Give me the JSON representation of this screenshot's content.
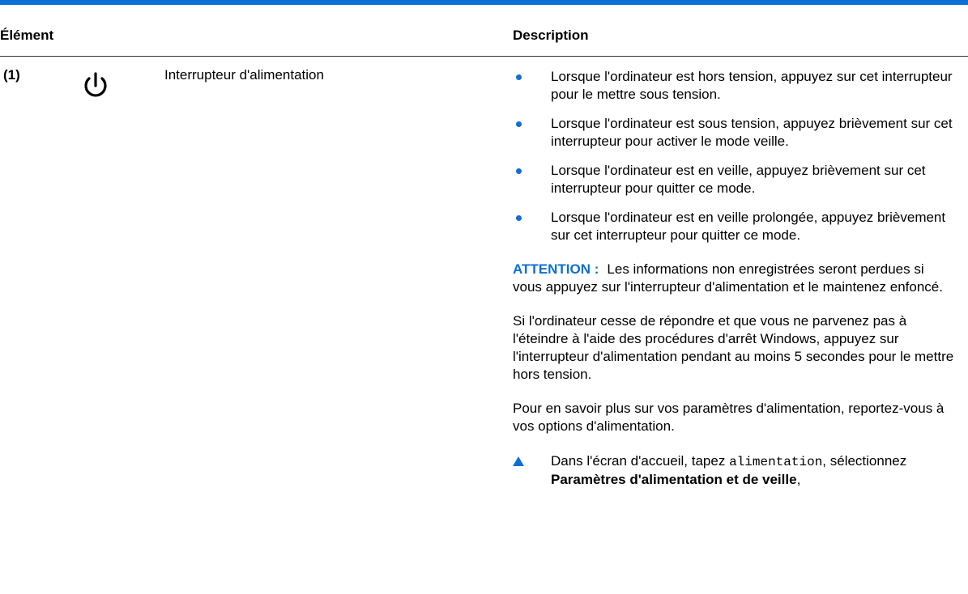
{
  "table": {
    "header_element": "Élément",
    "header_description": "Description"
  },
  "row": {
    "index": "(1)",
    "icon": "power-icon",
    "name": "Interrupteur d'alimentation",
    "bullets": [
      "Lorsque l'ordinateur est hors tension, appuyez sur cet interrupteur pour le mettre sous tension.",
      "Lorsque l'ordinateur est sous tension, appuyez brièvement sur cet interrupteur pour activer le mode veille.",
      "Lorsque l'ordinateur est en veille, appuyez brièvement sur cet interrupteur pour quitter ce mode.",
      "Lorsque l'ordinateur est en veille prolongée, appuyez brièvement sur cet interrupteur pour quitter ce mode."
    ],
    "attention_label": "ATTENTION :",
    "attention_text": "Les informations non enregistrées seront perdues si vous appuyez sur l'interrupteur d'alimentation et le maintenez enfoncé.",
    "windows_paragraph": "Si l'ordinateur cesse de répondre et que vous ne parvenez pas à l'éteindre à l'aide des procédures d'arrêt Windows, appuyez sur l'interrupteur d'alimentation pendant au moins 5 secondes pour le mettre hors tension.",
    "info_paragraph": "Pour en savoir plus sur vos paramètres d'alimentation, reportez-vous à vos options d'alimentation.",
    "step": {
      "prefix": "Dans l'écran d'accueil, tapez",
      "code": "alimentation",
      "middle": ", sélectionnez",
      "bold": "Paramètres d'alimentation et de veille",
      "suffix": ","
    }
  },
  "colors": {
    "accent": "#0b6fd6",
    "rule": "#333333"
  }
}
